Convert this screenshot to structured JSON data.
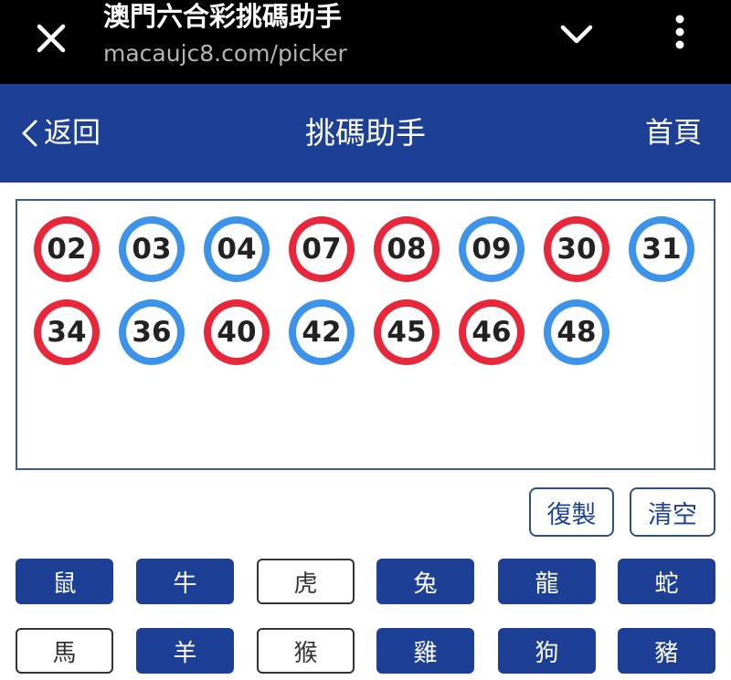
{
  "browser": {
    "title": "澳門六合彩挑碼助手",
    "url": "macaujc8.com/picker",
    "close_icon": "close-icon",
    "dropdown_icon": "chevron-down-icon",
    "menu_icon": "more-vert-icon"
  },
  "header": {
    "back_label": "返回",
    "title": "挑碼助手",
    "home_label": "首頁"
  },
  "selected_numbers": [
    {
      "number": "02",
      "color": "red"
    },
    {
      "number": "03",
      "color": "blue"
    },
    {
      "number": "04",
      "color": "blue"
    },
    {
      "number": "07",
      "color": "red"
    },
    {
      "number": "08",
      "color": "red"
    },
    {
      "number": "09",
      "color": "blue"
    },
    {
      "number": "30",
      "color": "red"
    },
    {
      "number": "31",
      "color": "blue"
    },
    {
      "number": "34",
      "color": "red"
    },
    {
      "number": "36",
      "color": "blue"
    },
    {
      "number": "40",
      "color": "red"
    },
    {
      "number": "42",
      "color": "blue"
    },
    {
      "number": "45",
      "color": "red"
    },
    {
      "number": "46",
      "color": "red"
    },
    {
      "number": "48",
      "color": "blue"
    }
  ],
  "actions": {
    "copy_label": "復製",
    "clear_label": "清空"
  },
  "zodiac": [
    {
      "label": "鼠",
      "selected": true
    },
    {
      "label": "牛",
      "selected": true
    },
    {
      "label": "虎",
      "selected": false
    },
    {
      "label": "兔",
      "selected": true
    },
    {
      "label": "龍",
      "selected": true
    },
    {
      "label": "蛇",
      "selected": true
    },
    {
      "label": "馬",
      "selected": false
    },
    {
      "label": "羊",
      "selected": true
    },
    {
      "label": "猴",
      "selected": false
    },
    {
      "label": "雞",
      "selected": true
    },
    {
      "label": "狗",
      "selected": true
    },
    {
      "label": "豬",
      "selected": true
    }
  ],
  "colors": {
    "header_bg": "#1d4096",
    "red_ball": "#e8283a",
    "blue_ball": "#3d93ea"
  }
}
